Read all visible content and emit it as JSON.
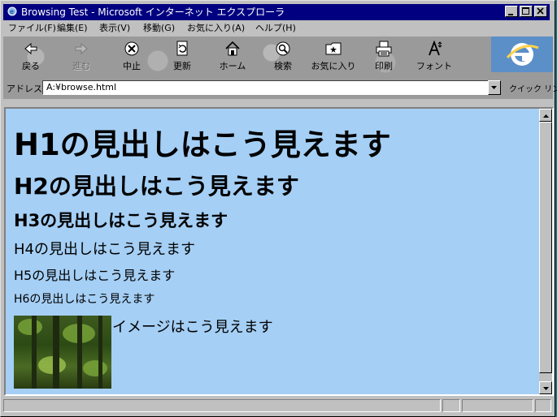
{
  "window": {
    "title": "Browsing Test - Microsoft インターネット エクスプローラ"
  },
  "menu": [
    {
      "label": "ファイル(F)"
    },
    {
      "label": "編集(E)"
    },
    {
      "label": "表示(V)"
    },
    {
      "label": "移動(G)"
    },
    {
      "label": "お気に入り(A)"
    },
    {
      "label": "ヘルプ(H)"
    }
  ],
  "toolbar": {
    "buttons": [
      {
        "label": "戻る",
        "icon": "back-arrow-icon",
        "enabled": true
      },
      {
        "label": "進む",
        "icon": "forward-arrow-icon",
        "enabled": false
      },
      {
        "label": "中止",
        "icon": "stop-icon",
        "enabled": true
      },
      {
        "label": "更新",
        "icon": "refresh-icon",
        "enabled": true
      },
      {
        "label": "ホーム",
        "icon": "home-icon",
        "enabled": true
      },
      {
        "label": "検索",
        "icon": "search-icon",
        "enabled": true
      },
      {
        "label": "お気に入り",
        "icon": "favorites-icon",
        "enabled": true
      },
      {
        "label": "印刷",
        "icon": "print-icon",
        "enabled": true
      },
      {
        "label": "フォント",
        "icon": "font-icon",
        "enabled": true
      }
    ]
  },
  "address": {
    "label": "アドレス",
    "value": "A:¥browse.html",
    "quick_links": "クイック リンク"
  },
  "content": {
    "h1": "H1の見出しはこう見えます",
    "h2": "H2の見出しはこう見えます",
    "h3": "H3の見出しはこう見えます",
    "h4": "H4の見出しはこう見えます",
    "h5": "H5の見出しはこう見えます",
    "h6": "H6の見出しはこう見えます",
    "image_caption": "イメージはこう見えます"
  },
  "colors": {
    "page_background": "#a5cff5",
    "title_bar": "#000080",
    "chrome": "#c0c0c0"
  }
}
